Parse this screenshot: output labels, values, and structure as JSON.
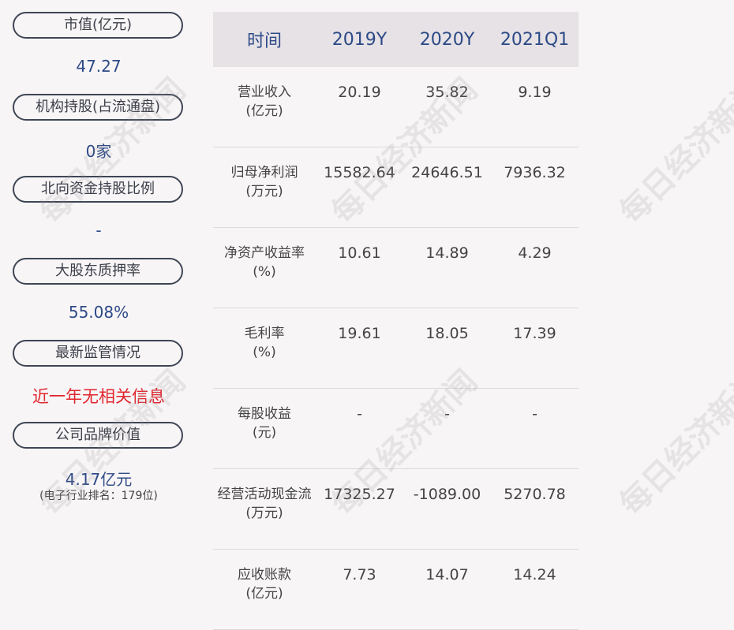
{
  "sidebar": [
    {
      "label": "市值(亿元)",
      "value": "47.27"
    },
    {
      "label": "机构持股(占流通盘)",
      "value": "0家"
    },
    {
      "label": "北向资金持股比例",
      "value": "-"
    },
    {
      "label": "大股东质押率",
      "value": "55.08%"
    },
    {
      "label": "最新监管情况",
      "value": "近一年无相关信息"
    },
    {
      "label": "公司品牌价值",
      "value": "4.17亿元",
      "note": "(电子行业排名：179位)"
    }
  ],
  "table": {
    "headers": [
      "时间",
      "2019Y",
      "2020Y",
      "2021Q1"
    ],
    "rows": [
      {
        "label1": "营业收入",
        "label2": "(亿元)",
        "values": [
          "20.19",
          "35.82",
          "9.19"
        ]
      },
      {
        "label1": "归母净利润",
        "label2": "(万元)",
        "values": [
          "15582.64",
          "24646.51",
          "7936.32"
        ]
      },
      {
        "label1": "净资产收益率",
        "label2": "(%)",
        "values": [
          "10.61",
          "14.89",
          "4.29"
        ]
      },
      {
        "label1": "毛利率",
        "label2": "(%)",
        "values": [
          "19.61",
          "18.05",
          "17.39"
        ]
      },
      {
        "label1": "每股收益",
        "label2": "(元)",
        "values": [
          "-",
          "-",
          "-"
        ]
      },
      {
        "label1": "经营活动现金流",
        "label2": "(万元)",
        "values": [
          "17325.27",
          "-1089.00",
          "5270.78"
        ]
      },
      {
        "label1": "应收账款",
        "label2": "(亿元)",
        "values": [
          "7.73",
          "14.07",
          "14.24"
        ]
      }
    ]
  },
  "watermark": "每日经济新闻",
  "colors": {
    "accent": "#2d4a86",
    "alert": "#e0262d",
    "header_bg": "#e6e2e6",
    "background": "#f8f5f7"
  }
}
